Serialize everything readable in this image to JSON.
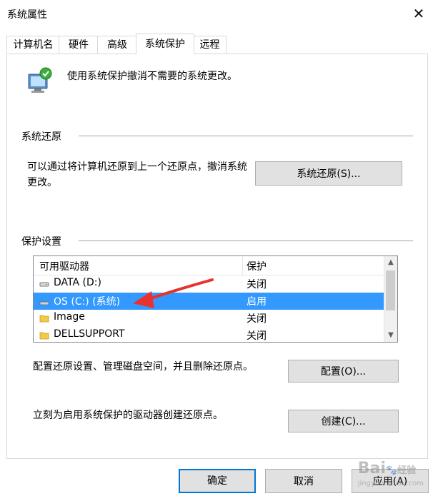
{
  "window": {
    "title": "系统属性",
    "close_icon": "close-icon"
  },
  "tabs": [
    {
      "label": "计算机名"
    },
    {
      "label": "硬件"
    },
    {
      "label": "高级"
    },
    {
      "label": "系统保护"
    },
    {
      "label": "远程"
    }
  ],
  "active_tab": "系统保护",
  "header": {
    "text": "使用系统保护撤消不需要的系统更改。",
    "icon": "system-protection-icon"
  },
  "restore": {
    "section_title": "系统还原",
    "description": "可以通过将计算机还原到上一个还原点，撤消系统更改。",
    "button": "系统还原(S)..."
  },
  "protection": {
    "section_title": "保护设置",
    "columns": [
      "可用驱动器",
      "保护"
    ],
    "drives": [
      {
        "name": "DATA (D:)",
        "protection": "关闭",
        "icon": "drive-icon",
        "selected": false
      },
      {
        "name": "OS (C:) (系统)",
        "protection": "启用",
        "icon": "windows-drive-icon",
        "selected": true
      },
      {
        "name": "Image",
        "protection": "关闭",
        "icon": "folder-icon",
        "selected": false
      },
      {
        "name": "DELLSUPPORT",
        "protection": "关闭",
        "icon": "folder-icon",
        "selected": false
      }
    ],
    "configure_text": "配置还原设置、管理磁盘空间，并且删除还原点。",
    "configure_button": "配置(O)...",
    "create_text": "立刻为启用系统保护的驱动器创建还原点。",
    "create_button": "创建(C)..."
  },
  "footer": {
    "ok": "确定",
    "cancel": "取消",
    "apply": "应用(A)"
  },
  "watermark": {
    "brand": "Bai",
    "brand_suffix": "经验",
    "url": "jingyan.baidu.com"
  },
  "colors": {
    "accent": "#0078d7",
    "selection": "#3399ff",
    "annotation_arrow": "#e8322f"
  }
}
